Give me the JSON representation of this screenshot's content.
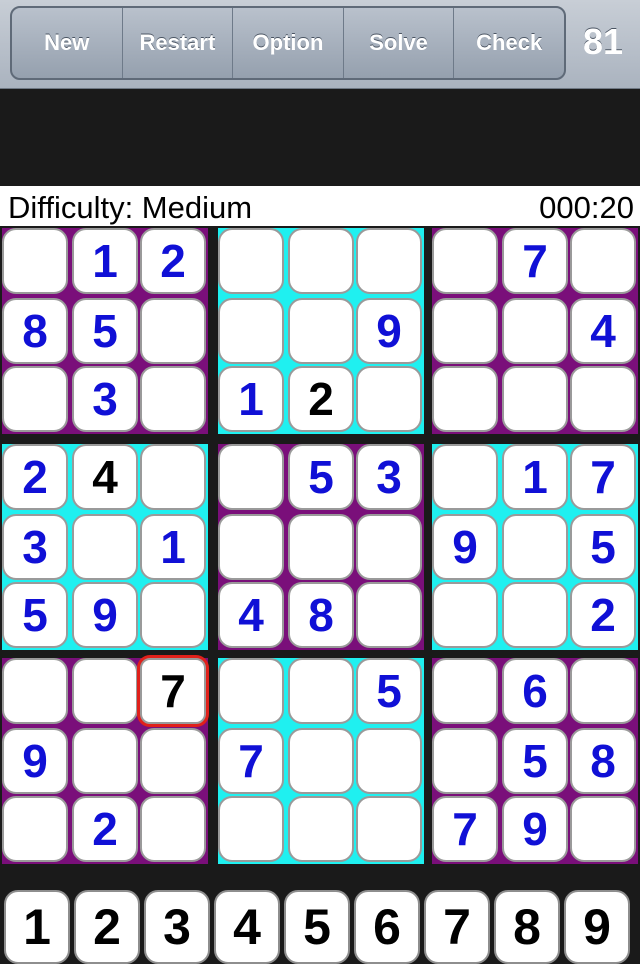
{
  "toolbar": {
    "buttons": [
      "New",
      "Restart",
      "Option",
      "Solve",
      "Check"
    ],
    "count": "81"
  },
  "status": {
    "difficulty": "Difficulty: Medium",
    "timer": "000:20"
  },
  "colors": {
    "given_digit": "#1010d6",
    "user_digit": "#000000",
    "block_purple": "#7a0f7a",
    "block_cyan": "#1ff0f0",
    "selected_outline": "#e0201a"
  },
  "grid": [
    [
      "",
      "1",
      "2",
      "",
      "",
      "",
      "",
      "7",
      ""
    ],
    [
      "8",
      "5",
      "",
      "",
      "",
      "9",
      "",
      "",
      "4"
    ],
    [
      "",
      "3",
      "",
      "1",
      "2",
      "",
      "",
      "",
      ""
    ],
    [
      "2",
      "4",
      "",
      "",
      "5",
      "3",
      "",
      "1",
      "7"
    ],
    [
      "3",
      "",
      "1",
      "",
      "",
      "",
      "9",
      "",
      "5"
    ],
    [
      "5",
      "9",
      "",
      "4",
      "8",
      "",
      "",
      "",
      "2"
    ],
    [
      "",
      "",
      "7",
      "",
      "",
      "5",
      "",
      "6",
      ""
    ],
    [
      "9",
      "",
      "",
      "7",
      "",
      "",
      "",
      "5",
      "8"
    ],
    [
      "",
      "2",
      "",
      "",
      "",
      "",
      "7",
      "9",
      ""
    ]
  ],
  "user_entries": [
    [
      2,
      4
    ],
    [
      3,
      1
    ],
    [
      6,
      2
    ]
  ],
  "selected_cell": [
    6,
    2
  ],
  "keypad": [
    "1",
    "2",
    "3",
    "4",
    "5",
    "6",
    "7",
    "8",
    "9"
  ]
}
